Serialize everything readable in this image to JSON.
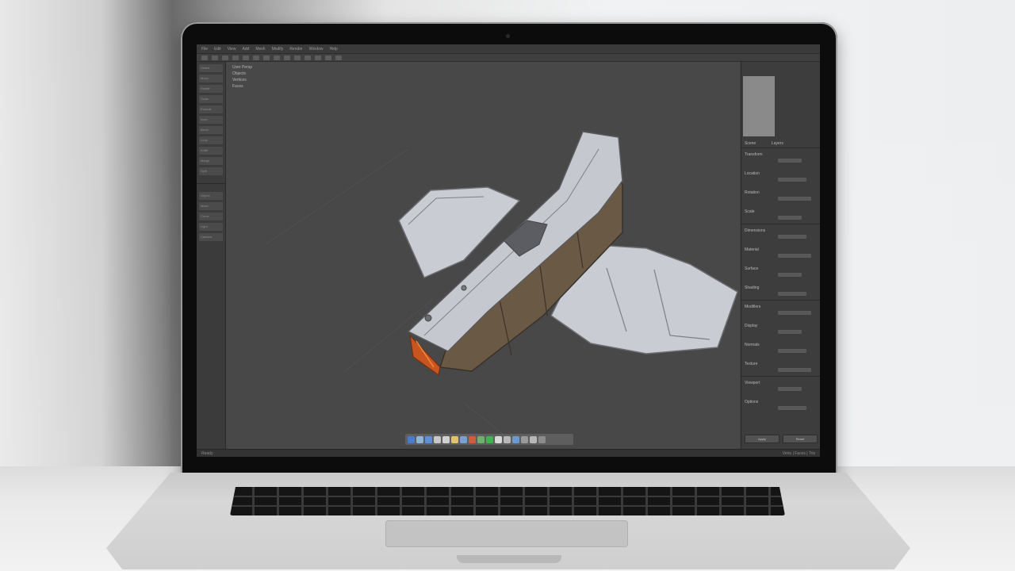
{
  "app": {
    "menu": [
      "File",
      "Edit",
      "View",
      "Add",
      "Mesh",
      "Modify",
      "Render",
      "Window",
      "Help"
    ],
    "toolbar_icons": [
      "select-icon",
      "move-icon",
      "rotate-icon",
      "scale-icon",
      "snap-icon",
      "mirror-icon",
      "extrude-icon",
      "bevel-icon",
      "loop-cut-icon",
      "knife-icon",
      "merge-icon",
      "camera-icon",
      "light-icon",
      "render-icon"
    ]
  },
  "left_panel": {
    "items": [
      "Select",
      "Move",
      "Rotate",
      "Scale",
      "Extrude",
      "Inset",
      "Bevel",
      "Loop",
      "Knife",
      "Merge",
      "Split"
    ],
    "lower_items": [
      "Object",
      "Mesh",
      "Curve",
      "Light",
      "Camera"
    ]
  },
  "viewport": {
    "overlay_lines": [
      "User Persp",
      "Objects",
      "Vertices",
      "Faces"
    ],
    "model": "spaceship-model"
  },
  "right_panel": {
    "tabs": [
      "Scene",
      "Layers"
    ],
    "sections": [
      "Transform",
      "Location",
      "Rotation",
      "Scale",
      "Dimensions",
      "Material",
      "Surface",
      "Shading",
      "Modifiers",
      "Display",
      "Normals",
      "Texture",
      "Viewport",
      "Options"
    ],
    "buttons": [
      "Apply",
      "Reset"
    ]
  },
  "dock": {
    "icons": [
      {
        "name": "finder-icon",
        "color": "#4a7dc9"
      },
      {
        "name": "browser-icon",
        "color": "#8fb3d9"
      },
      {
        "name": "mail-icon",
        "color": "#5c8fd6"
      },
      {
        "name": "photos-icon",
        "color": "#c7c7c7"
      },
      {
        "name": "music-icon",
        "color": "#d0d0d0"
      },
      {
        "name": "notes-icon",
        "color": "#e0c36a"
      },
      {
        "name": "app-icon",
        "color": "#7aa0d0"
      },
      {
        "name": "tool-icon",
        "color": "#d35b3b"
      },
      {
        "name": "maps-icon",
        "color": "#6fb06a"
      },
      {
        "name": "messages-icon",
        "color": "#3fb34f"
      },
      {
        "name": "calendar-icon",
        "color": "#d9d9d9"
      },
      {
        "name": "contacts-icon",
        "color": "#b8b8b8"
      },
      {
        "name": "store-icon",
        "color": "#6a9ad0"
      },
      {
        "name": "settings-icon",
        "color": "#9a9a9a"
      },
      {
        "name": "folder-icon",
        "color": "#b7b7b7"
      },
      {
        "name": "trash-icon",
        "color": "#8c8c8c"
      }
    ]
  },
  "statusbar": {
    "left": "Ready",
    "right": "Verts | Faces | Tris"
  }
}
